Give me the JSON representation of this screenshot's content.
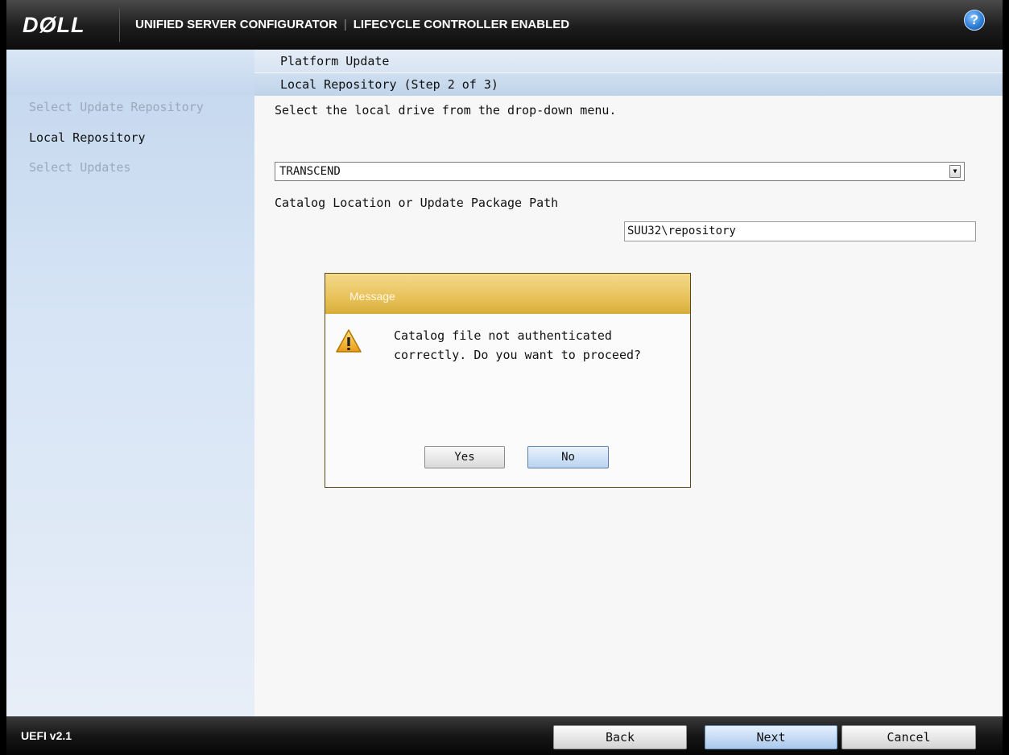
{
  "header": {
    "logo": "DØLL",
    "title_left": "UNIFIED SERVER CONFIGURATOR",
    "title_separator": "|",
    "title_right": "LIFECYCLE CONTROLLER ENABLED",
    "help_glyph": "?"
  },
  "breadcrumb": {
    "section": "Platform Update",
    "step": "Local Repository (Step 2 of 3)"
  },
  "sidebar": {
    "items": [
      {
        "label": "Select Update Repository",
        "state": "dim"
      },
      {
        "label": "Local Repository",
        "state": "active"
      },
      {
        "label": "Select Updates",
        "state": "dim"
      }
    ]
  },
  "main": {
    "instruction": "Select the local drive from the drop-down menu.",
    "drive_select": {
      "value": "TRANSCEND"
    },
    "path_label": "Catalog Location or Update Package Path",
    "path_input": {
      "value": "SUU32\\repository"
    }
  },
  "dialog": {
    "title": "Message",
    "icon": "warning-icon",
    "message": "Catalog file not authenticated correctly. Do you want to proceed?",
    "yes_label": "Yes",
    "no_label": "No"
  },
  "footer": {
    "version": "UEFI v2.1",
    "back_label": "Back",
    "next_label": "Next",
    "cancel_label": "Cancel"
  },
  "colors": {
    "sidebar_bg": "#d6e4f5",
    "dialog_title_bg": "#e8c25a",
    "primary_button": "#b9d3f0"
  }
}
